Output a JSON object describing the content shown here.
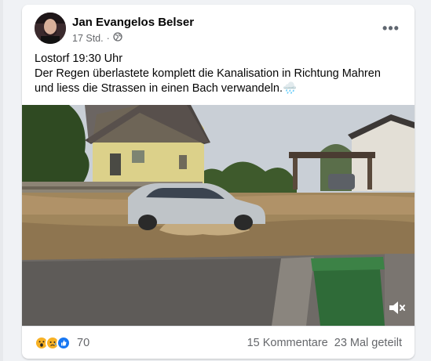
{
  "post": {
    "author": "Jan Evangelos Belser",
    "time": "17 Std.",
    "privacy_icon": "globe-icon",
    "text_line1": "Lostorf 19:30 Uhr",
    "text_line2": "Der Regen überlastete komplett die Kanalisation in Richtung Mahren",
    "text_line3": "und liess die Strassen in einen Bach verwandeln.",
    "text_emoji": "🌧️"
  },
  "media": {
    "mute_icon": "speaker-muted-icon"
  },
  "stats": {
    "reaction_icons": [
      "wow-reaction-icon",
      "sad-reaction-icon",
      "like-reaction-icon"
    ],
    "reaction_count": "70",
    "comments": "15 Kommentare",
    "shares": "23 Mal geteilt"
  },
  "colors": {
    "background": "#f0f2f5",
    "card": "#ffffff",
    "secondary_text": "#65676b",
    "like_blue": "#1877f2",
    "reaction_yellow": "#f7b125"
  }
}
